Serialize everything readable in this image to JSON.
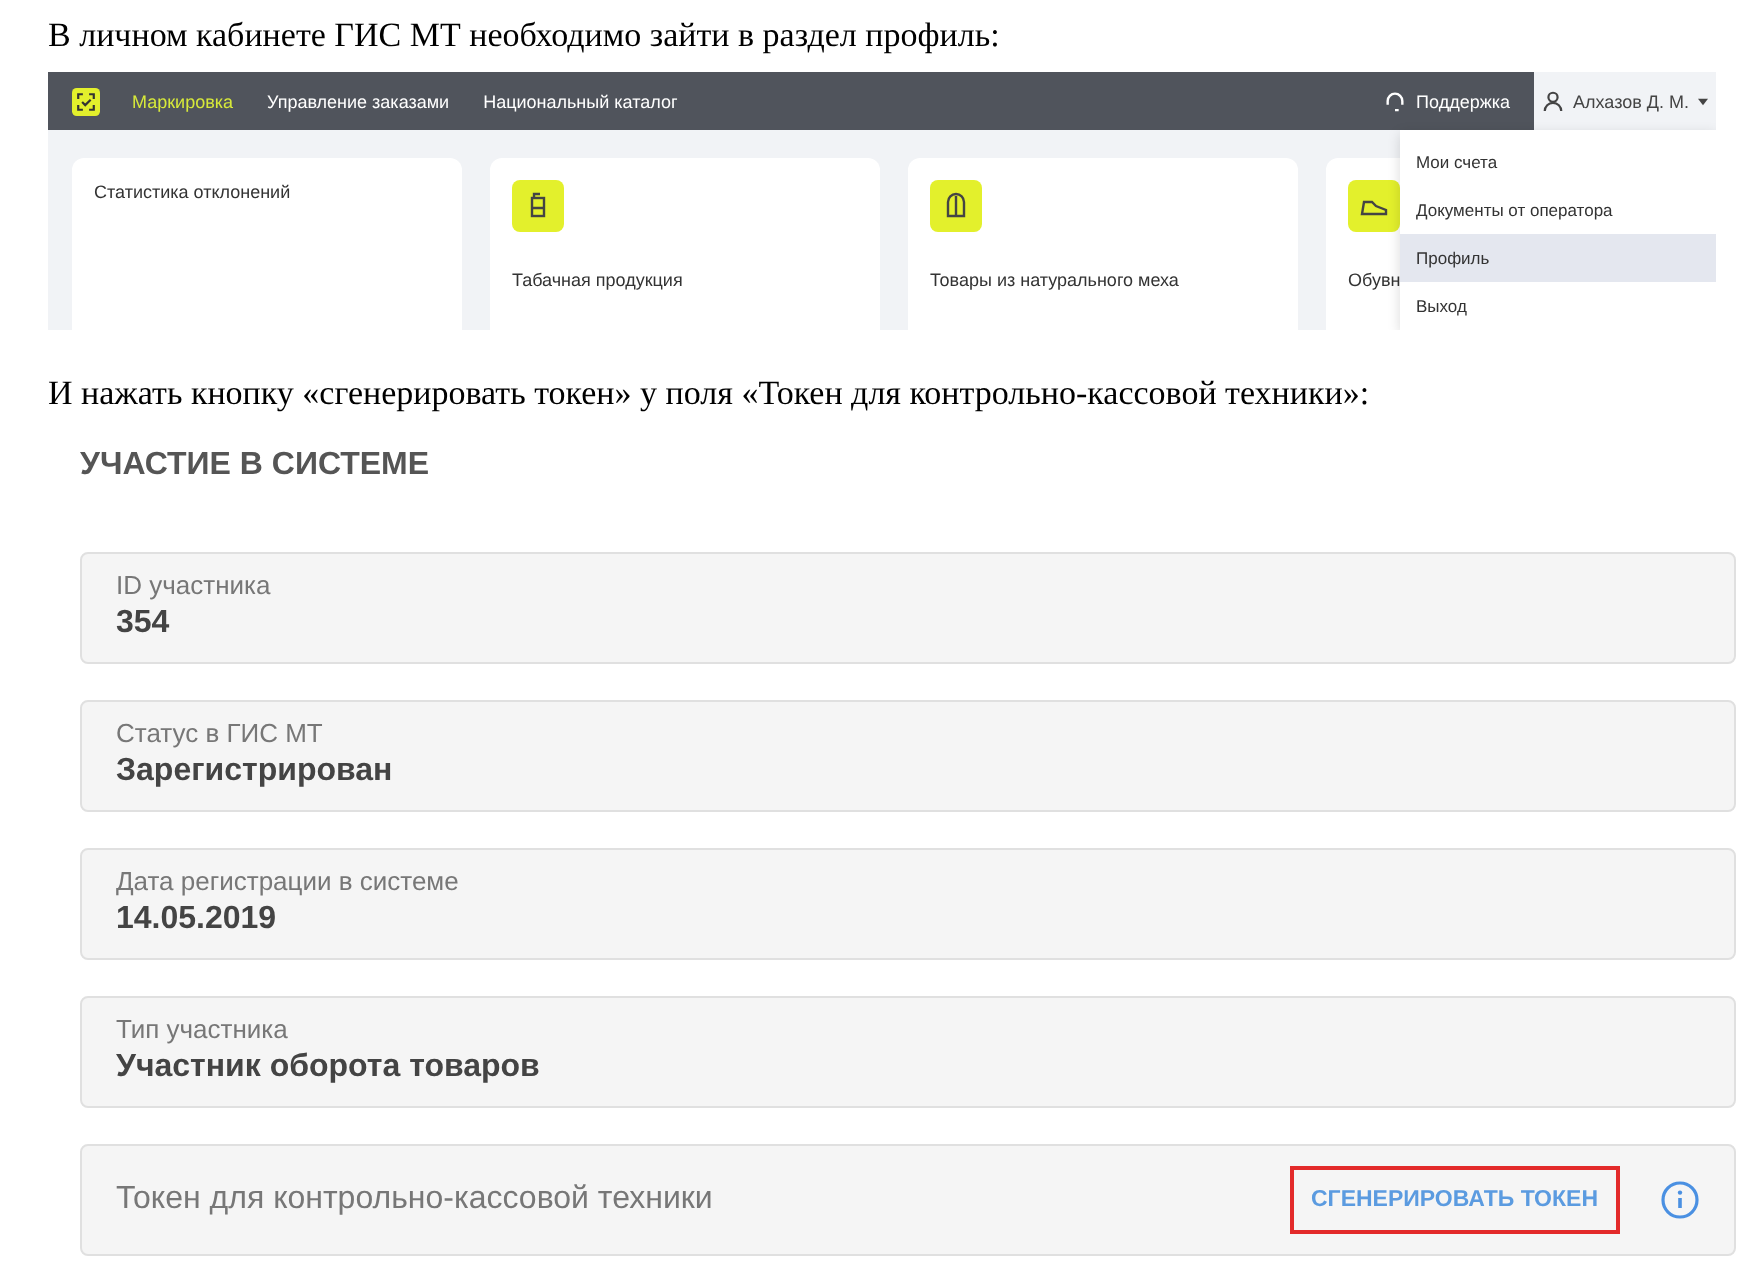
{
  "intro_text": "В личном кабинете ГИС МТ необходимо зайти в раздел профиль:",
  "portal": {
    "nav": [
      {
        "label": "Маркировка",
        "selected": true
      },
      {
        "label": "Управление заказами",
        "selected": false
      },
      {
        "label": "Национальный каталог",
        "selected": false
      }
    ],
    "support": "Поддержка",
    "user": "Алхазов Д. М.",
    "cards": [
      {
        "kind": "stats",
        "title": "Статистика отклонений"
      },
      {
        "kind": "tobacco",
        "title": "Табачная продукция"
      },
      {
        "kind": "fur",
        "title": "Товары из натурального меха"
      },
      {
        "kind": "shoes",
        "title": "Обувн"
      }
    ],
    "menu": [
      {
        "label": "Мои счета",
        "selected": false
      },
      {
        "label": "Документы от оператора",
        "selected": false
      },
      {
        "label": "Профиль",
        "selected": true
      },
      {
        "label": "Выход",
        "selected": false
      }
    ]
  },
  "step_text": "И нажать кнопку «сгенерировать токен» у поля «Токен для контрольно-кассовой техники»:",
  "profile": {
    "title": "УЧАСТИЕ В СИСТЕМЕ",
    "fields": [
      {
        "kind": "value",
        "label": "ID участника",
        "value": "354"
      },
      {
        "kind": "value",
        "label": "Статус в ГИС МТ",
        "value": "Зарегистрирован"
      },
      {
        "kind": "value",
        "label": "Дата регистрации в системе",
        "value": "14.05.2019"
      },
      {
        "kind": "value",
        "label": "Тип участника",
        "value": "Участник оборота товаров"
      },
      {
        "kind": "token",
        "label": "Токен для контрольно-кассовой техники",
        "button": "СГЕНЕРИРОВАТЬ ТОКЕН",
        "highlighted": true
      }
    ]
  }
}
